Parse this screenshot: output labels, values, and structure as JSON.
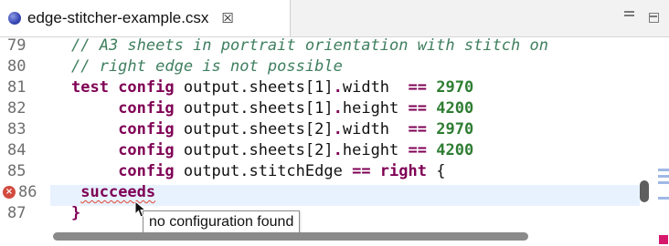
{
  "tab": {
    "title": "edge-stitcher-example.csx",
    "close_glyph": "☒",
    "icon": "csx-file-icon"
  },
  "window_controls": {
    "minimize": "minimize-icon",
    "maximize": "maximize-icon"
  },
  "editor": {
    "lines": [
      {
        "num": "79",
        "tokens": [
          {
            "t": "// A3 sheets in portrait orientation with stitch on",
            "c": "cmt"
          }
        ]
      },
      {
        "num": "80",
        "tokens": [
          {
            "t": "// right edge is not possible",
            "c": "cmt"
          }
        ]
      },
      {
        "num": "81",
        "tokens": [
          {
            "t": "test ",
            "c": "kw"
          },
          {
            "t": "config ",
            "c": "kw"
          },
          {
            "t": "output.sheets[1]",
            "c": "plain"
          },
          {
            "t": ".",
            "c": "op"
          },
          {
            "t": "width  ",
            "c": "plain"
          },
          {
            "t": "== ",
            "c": "op"
          },
          {
            "t": "2970",
            "c": "num"
          }
        ]
      },
      {
        "num": "82",
        "tokens": [
          {
            "t": "     ",
            "c": "plain"
          },
          {
            "t": "config ",
            "c": "kw"
          },
          {
            "t": "output.sheets[1]",
            "c": "plain"
          },
          {
            "t": ".",
            "c": "op"
          },
          {
            "t": "height ",
            "c": "plain"
          },
          {
            "t": "== ",
            "c": "op"
          },
          {
            "t": "4200",
            "c": "num"
          }
        ]
      },
      {
        "num": "83",
        "tokens": [
          {
            "t": "     ",
            "c": "plain"
          },
          {
            "t": "config ",
            "c": "kw"
          },
          {
            "t": "output.sheets[2]",
            "c": "plain"
          },
          {
            "t": ".",
            "c": "op"
          },
          {
            "t": "width  ",
            "c": "plain"
          },
          {
            "t": "== ",
            "c": "op"
          },
          {
            "t": "2970",
            "c": "num"
          }
        ]
      },
      {
        "num": "84",
        "tokens": [
          {
            "t": "     ",
            "c": "plain"
          },
          {
            "t": "config ",
            "c": "kw"
          },
          {
            "t": "output.sheets[2]",
            "c": "plain"
          },
          {
            "t": ".",
            "c": "op"
          },
          {
            "t": "height ",
            "c": "plain"
          },
          {
            "t": "== ",
            "c": "op"
          },
          {
            "t": "4200",
            "c": "num"
          }
        ]
      },
      {
        "num": "85",
        "tokens": [
          {
            "t": "     ",
            "c": "plain"
          },
          {
            "t": "config ",
            "c": "kw"
          },
          {
            "t": "output.stitchEdge ",
            "c": "plain"
          },
          {
            "t": "== ",
            "c": "op"
          },
          {
            "t": "right ",
            "c": "kw"
          },
          {
            "t": "{",
            "c": "plain"
          }
        ]
      },
      {
        "num": "86",
        "error": true,
        "tokens": [
          {
            "t": " ",
            "c": "plain"
          },
          {
            "t": "succeeds",
            "c": "kw err-underline"
          }
        ]
      },
      {
        "num": "87",
        "tokens": [
          {
            "t": "}",
            "c": "kw"
          }
        ]
      }
    ],
    "error_marker": "error-icon",
    "tooltip": "no configuration found"
  },
  "colors": {
    "comment": "#3f7f5f",
    "keyword": "#7f0055",
    "number": "#2e7d32",
    "current_line": "#e8f2fe",
    "error": "#d24b40"
  }
}
